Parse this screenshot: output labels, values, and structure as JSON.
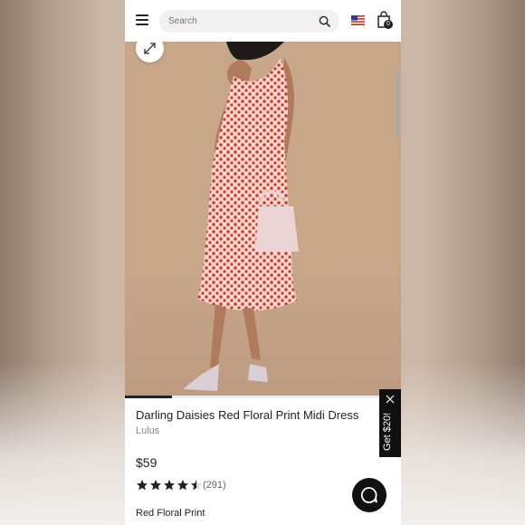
{
  "search": {
    "placeholder": "Search"
  },
  "cart": {
    "count": "0"
  },
  "product": {
    "title": "Darling Daisies Red Floral Print Midi Dress",
    "brand": "Lulus",
    "price": "$59",
    "rating": 4.5,
    "reviews": "(291)",
    "color": "Red Floral Print"
  },
  "gallery": {
    "progress": 0.17
  },
  "promo": {
    "label": "Get $20!"
  },
  "icons": [
    "menu-icon",
    "search-icon",
    "us-flag-icon",
    "shopping-bag-icon",
    "expand-icon",
    "close-icon",
    "chat-icon",
    "star-icon"
  ]
}
